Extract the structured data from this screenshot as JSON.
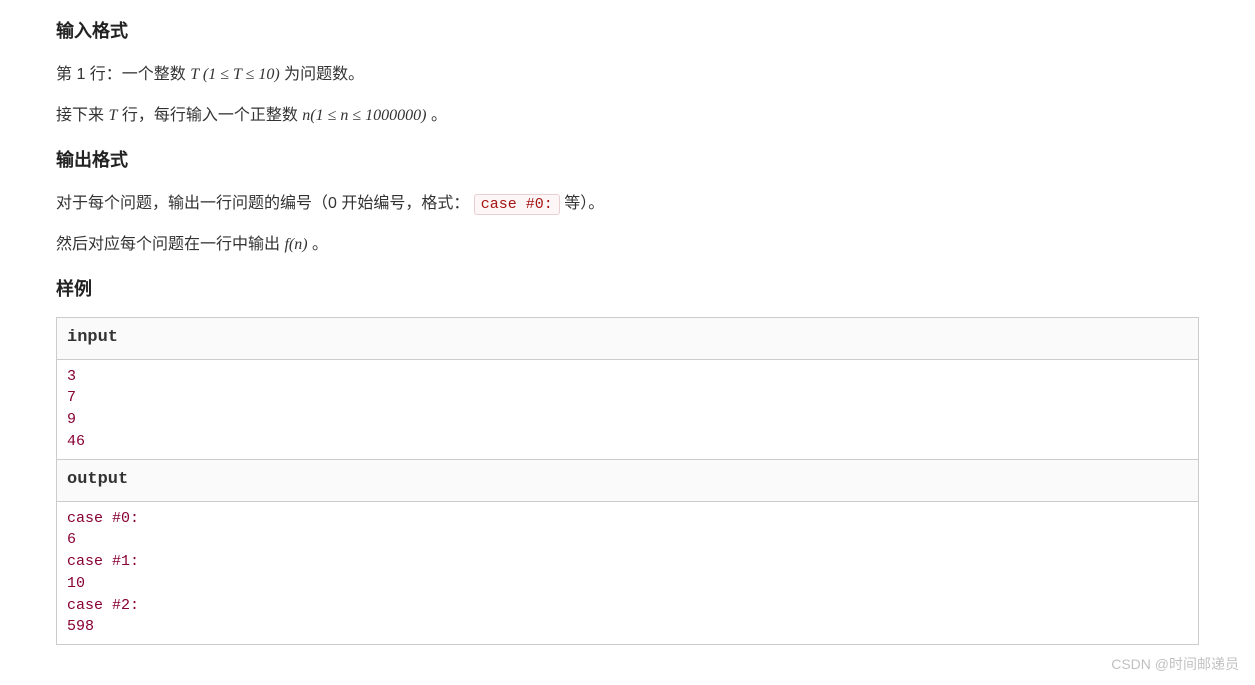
{
  "sections": {
    "input_format": {
      "heading": "输入格式",
      "line1_prefix": "第 1 行：一个整数 ",
      "line1_math": "T (1 ≤ T ≤ 10)",
      "line1_suffix": " 为问题数。",
      "line2_prefix": "接下来 ",
      "line2_math_T": "T",
      "line2_mid": " 行，每行输入一个正整数 ",
      "line2_math_n": "n(1 ≤ n ≤ 1000000)",
      "line2_suffix": "。"
    },
    "output_format": {
      "heading": "输出格式",
      "line1_prefix": "对于每个问题，输出一行问题的编号（0 开始编号，格式： ",
      "line1_code": "case #0:",
      "line1_suffix": " 等）。",
      "line2_prefix": "然后对应每个问题在一行中输出 ",
      "line2_math": "f(n)",
      "line2_suffix": "。"
    },
    "sample": {
      "heading": "样例",
      "input_label": "input",
      "output_label": "output",
      "input_data": "3\n7\n9\n46",
      "output_data": "case #0:\n6\ncase #1:\n10\ncase #2:\n598"
    }
  },
  "watermark": "CSDN @时间邮递员"
}
